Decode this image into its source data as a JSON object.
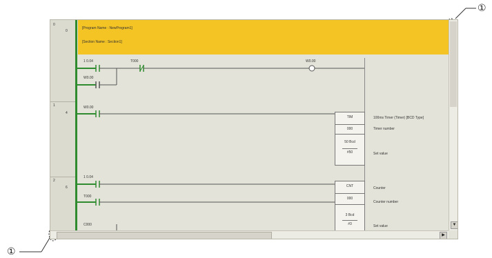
{
  "program_header": {
    "program_name": "[Program Name : NewProgram1]",
    "section_name": "[Section Name : Section1]"
  },
  "rungs": [
    {
      "rung": "0",
      "step": "0"
    },
    {
      "rung": "1",
      "step": "4"
    },
    {
      "rung": "2",
      "step": "6"
    }
  ],
  "rung0": {
    "contact1": "1 0.04",
    "contact2": "T000",
    "branch_contact": "W0.00",
    "coil": "W0.00"
  },
  "rung1": {
    "contact": "W0.00",
    "instr": "TIM",
    "operand1": "000",
    "operand2_label": "50 Bcd",
    "operand2": "#50",
    "comment_title": "100ms Timer (Timer) [BCD Type]",
    "comment_op1": "Timer number",
    "comment_op2": "Set value"
  },
  "rung2": {
    "contact1": "1 0.04",
    "contact2": "T000",
    "contact3": "C000",
    "instr": "CNT",
    "operand1": "000",
    "operand2_label": "3 Bcd",
    "operand2": "#3",
    "comment_title": "Counter",
    "comment_op1": "Counter number",
    "comment_op2": "Set value"
  },
  "callouts": {
    "top_right": "①",
    "bottom_left": "①"
  },
  "colors": {
    "header_bg": "#f4c324",
    "rung_green": "#2e8b2e",
    "editor_bg": "#e4e3d9"
  }
}
